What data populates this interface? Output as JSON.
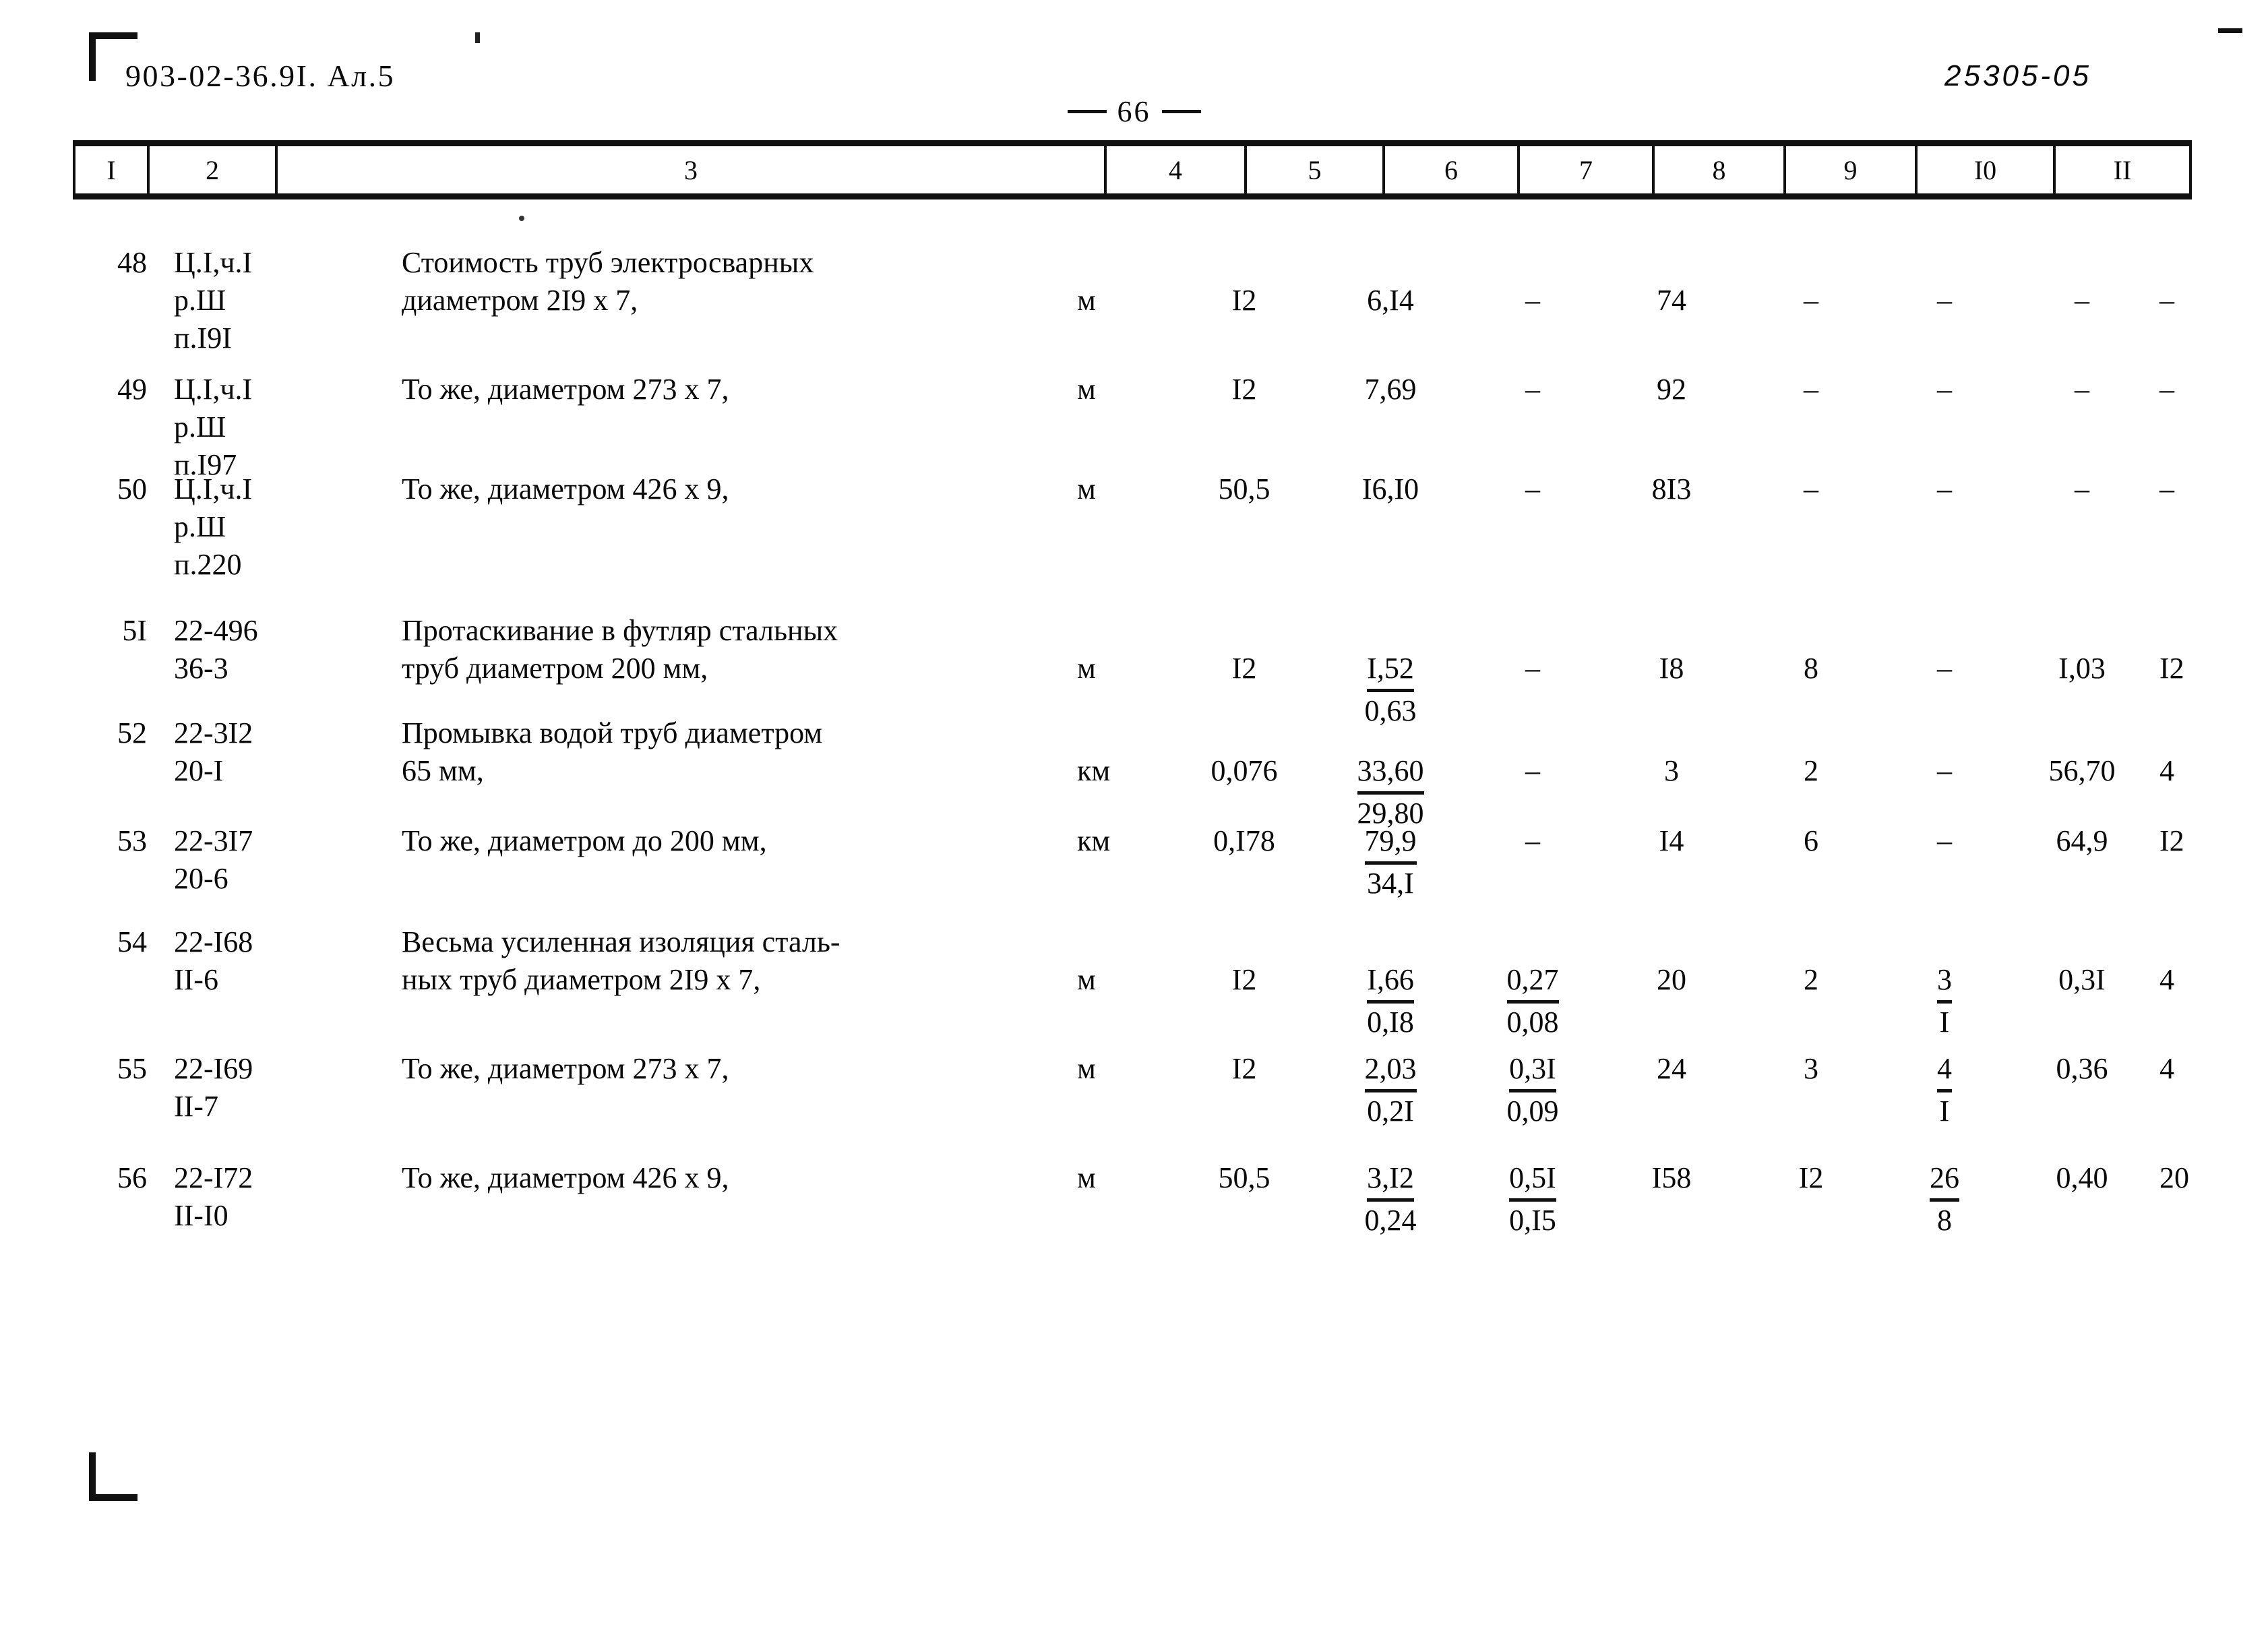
{
  "header": {
    "doc_code": "903-02-36.9I. Ал.5",
    "stamp": "25305-05",
    "page_number": "66"
  },
  "table": {
    "column_headers": [
      "I",
      "2",
      "3",
      "4",
      "5",
      "6",
      "7",
      "8",
      "9",
      "I0",
      "II"
    ],
    "rows": [
      {
        "num": "48",
        "code_lines": [
          "Ц.I,ч.I",
          "р.Ш",
          "п.I9I"
        ],
        "desc_lines": [
          "Стоимость труб электросварных",
          "диаметром 2I9 х 7,"
        ],
        "unit": "м",
        "c4": "I2",
        "c5_top": "6,I4",
        "c5_bot": "",
        "c6_top": "–",
        "c6_bot": "",
        "c7": "74",
        "c8": "–",
        "c9_top": "–",
        "c9_bot": "",
        "c10": "–",
        "c11": "–"
      },
      {
        "num": "49",
        "code_lines": [
          "Ц.I,ч.I",
          "р.Ш",
          "п.I97"
        ],
        "desc_lines": [
          "То же, диаметром 273 х 7,"
        ],
        "unit": "м",
        "c4": "I2",
        "c5_top": "7,69",
        "c5_bot": "",
        "c6_top": "–",
        "c6_bot": "",
        "c7": "92",
        "c8": "–",
        "c9_top": "–",
        "c9_bot": "",
        "c10": "–",
        "c11": "–"
      },
      {
        "num": "50",
        "code_lines": [
          "Ц.I,ч.I",
          "р.Ш",
          "п.220"
        ],
        "desc_lines": [
          "То же, диаметром 426 х 9,"
        ],
        "unit": "м",
        "c4": "50,5",
        "c5_top": "I6,I0",
        "c5_bot": "",
        "c6_top": "–",
        "c6_bot": "",
        "c7": "8I3",
        "c8": "–",
        "c9_top": "–",
        "c9_bot": "",
        "c10": "–",
        "c11": "–"
      },
      {
        "num": "5I",
        "code_lines": [
          "22-496",
          "36-3"
        ],
        "desc_lines": [
          "Протаскивание в футляр стальных",
          "труб диаметром 200 мм,"
        ],
        "unit": "м",
        "c4": "I2",
        "c5_top": "I,52",
        "c5_bot": "0,63",
        "c6_top": "–",
        "c6_bot": "",
        "c7": "I8",
        "c8": "8",
        "c9_top": "–",
        "c9_bot": "",
        "c10": "I,03",
        "c11": "I2"
      },
      {
        "num": "52",
        "code_lines": [
          "22-3I2",
          "20-I"
        ],
        "desc_lines": [
          "Промывка водой труб диаметром",
          "65 мм,"
        ],
        "unit": "км",
        "c4": "0,076",
        "c5_top": "33,60",
        "c5_bot": "29,80",
        "c6_top": "–",
        "c6_bot": "",
        "c7": "3",
        "c8": "2",
        "c9_top": "–",
        "c9_bot": "",
        "c10": "56,70",
        "c11": "4"
      },
      {
        "num": "53",
        "code_lines": [
          "22-3I7",
          "20-6"
        ],
        "desc_lines": [
          "То же, диаметром до 200 мм,"
        ],
        "unit": "км",
        "c4": "0,I78",
        "c5_top": "79,9",
        "c5_bot": "34,I",
        "c6_top": "–",
        "c6_bot": "",
        "c7": "I4",
        "c8": "6",
        "c9_top": "–",
        "c9_bot": "",
        "c10": "64,9",
        "c11": "I2"
      },
      {
        "num": "54",
        "code_lines": [
          "22-I68",
          "II-6"
        ],
        "desc_lines": [
          "Весьма усиленная изоляция сталь-",
          "ных труб диаметром 2I9 х 7,"
        ],
        "unit": "м",
        "c4": "I2",
        "c5_top": "I,66",
        "c5_bot": "0,I8",
        "c6_top": "0,27",
        "c6_bot": "0,08",
        "c7": "20",
        "c8": "2",
        "c9_top": "3",
        "c9_bot": "I",
        "c10": "0,3I",
        "c11": "4"
      },
      {
        "num": "55",
        "code_lines": [
          "22-I69",
          "II-7"
        ],
        "desc_lines": [
          "То же, диаметром 273 х 7,"
        ],
        "unit": "м",
        "c4": "I2",
        "c5_top": "2,03",
        "c5_bot": "0,2I",
        "c6_top": "0,3I",
        "c6_bot": "0,09",
        "c7": "24",
        "c8": "3",
        "c9_top": "4",
        "c9_bot": "I",
        "c10": "0,36",
        "c11": "4"
      },
      {
        "num": "56",
        "code_lines": [
          "22-I72",
          "II-I0"
        ],
        "desc_lines": [
          "То же, диаметром 426 х 9,"
        ],
        "unit": "м",
        "c4": "50,5",
        "c5_top": "3,I2",
        "c5_bot": "0,24",
        "c6_top": "0,5I",
        "c6_bot": "0,I5",
        "c7": "I58",
        "c8": "I2",
        "c9_top": "26",
        "c9_bot": "8",
        "c10": "0,40",
        "c11": "20"
      }
    ]
  }
}
